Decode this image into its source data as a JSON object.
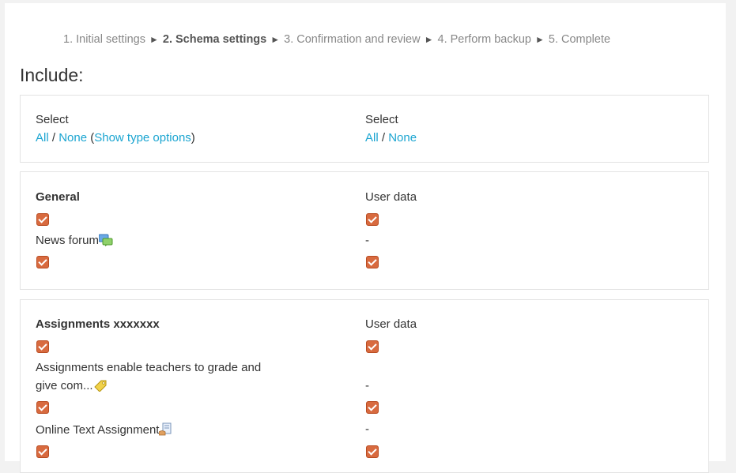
{
  "steps": [
    {
      "label": "1. Initial settings",
      "current": false
    },
    {
      "label": "2. Schema settings",
      "current": true
    },
    {
      "label": "3. Confirmation and review",
      "current": false
    },
    {
      "label": "4. Perform backup",
      "current": false
    },
    {
      "label": "5. Complete",
      "current": false
    }
  ],
  "step_separator": "►",
  "include_heading": "Include:",
  "select_box": {
    "left": {
      "title": "Select",
      "all": "All",
      "sep": " / ",
      "none": "None",
      "open_paren": " (",
      "type_options": "Show type options",
      "close_paren": ")"
    },
    "right": {
      "title": "Select",
      "all": "All",
      "sep": " / ",
      "none": "None"
    }
  },
  "general_section": {
    "title": "General",
    "userdata_label": "User data",
    "item_name": "News forum",
    "item_icon": "forum-icon",
    "item_userdata": "-"
  },
  "assignments_section": {
    "title": "Assignments xxxxxxx",
    "userdata_label": "User data",
    "item1_line1": "Assignments enable teachers to grade and",
    "item1_line2": "give com...",
    "item1_icon": "assignment-tag-icon",
    "item1_userdata": "-",
    "item2_name": "Online Text Assignment",
    "item2_icon": "text-assignment-icon",
    "item2_userdata": "-"
  },
  "colors": {
    "link": "#1ba5d1",
    "checkbox": "#d86a3f"
  }
}
